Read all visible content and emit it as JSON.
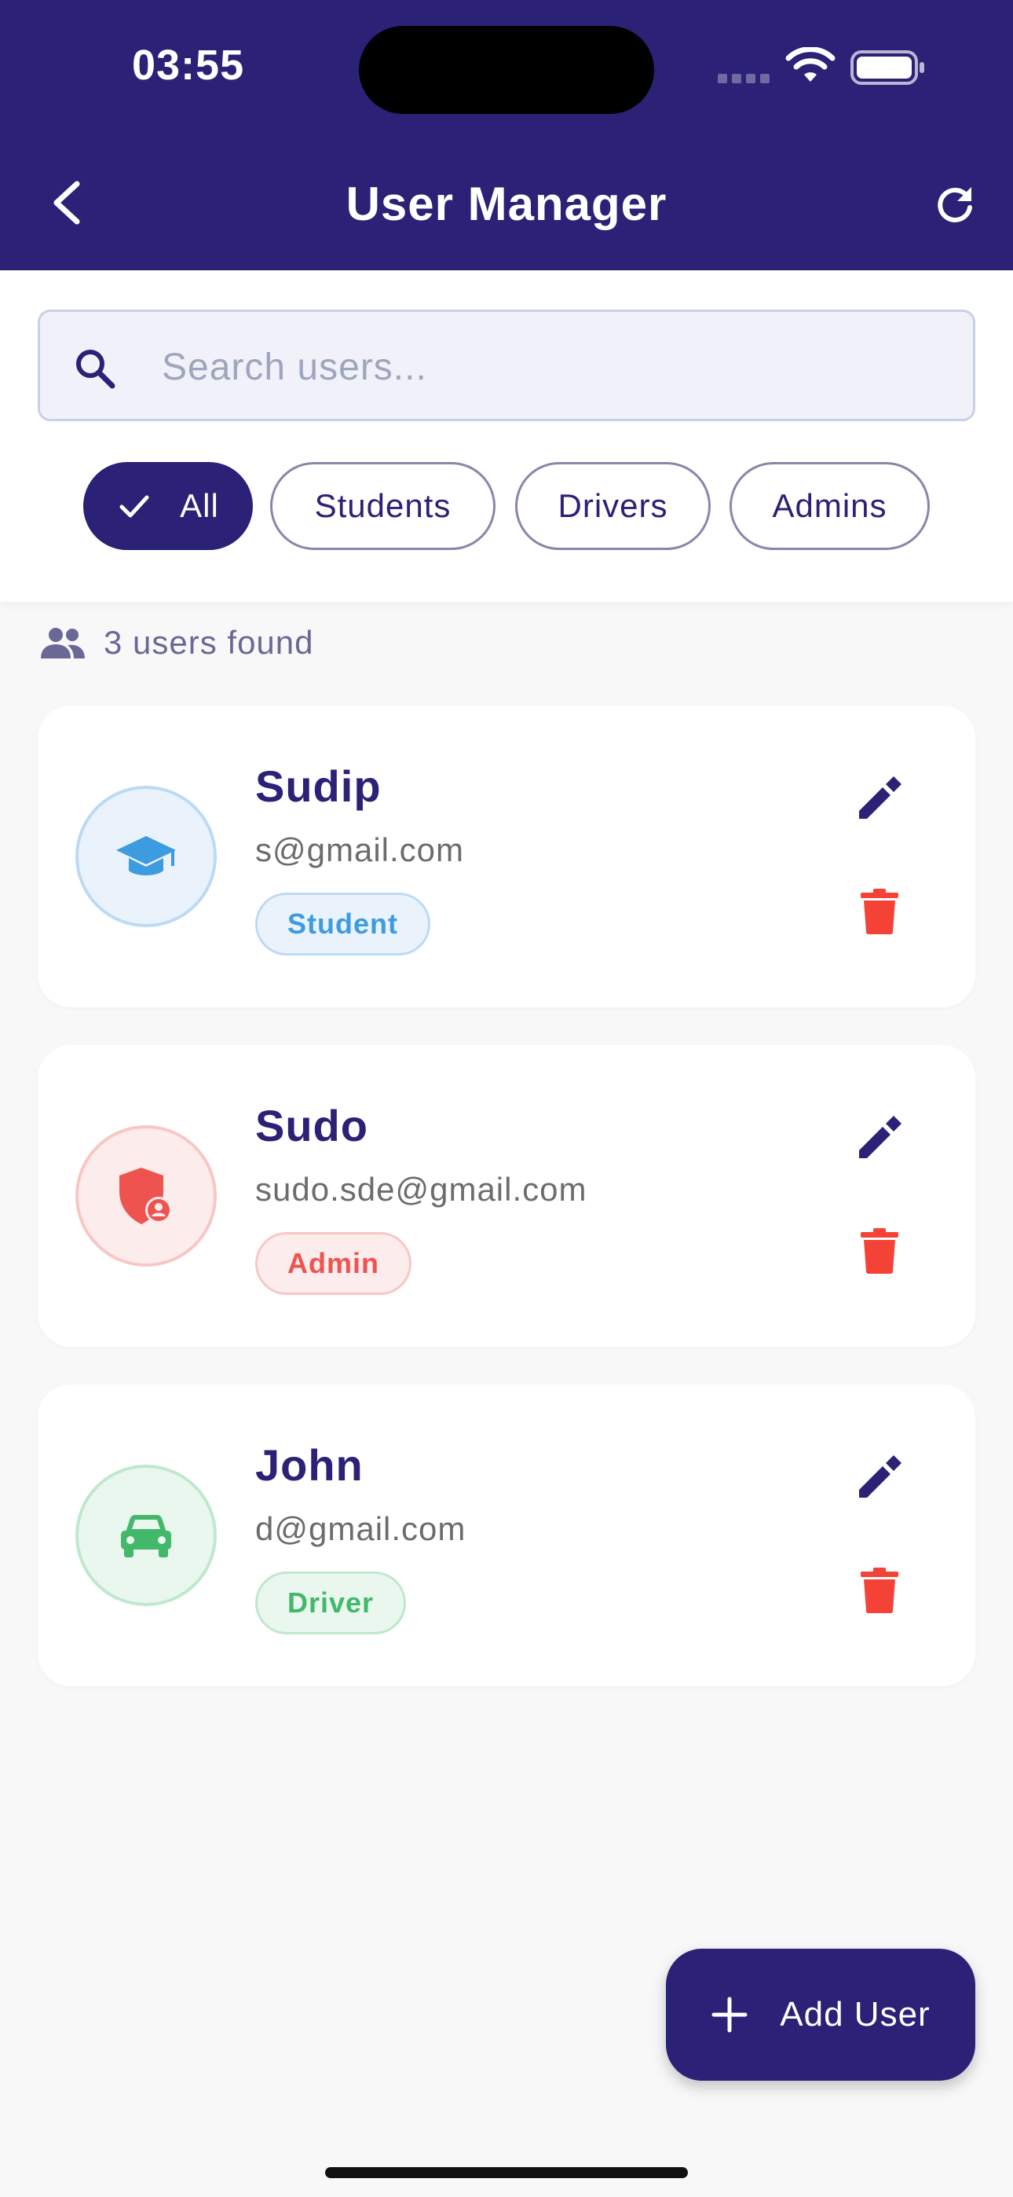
{
  "status_bar": {
    "time": "03:55"
  },
  "header": {
    "title": "User Manager"
  },
  "search": {
    "placeholder": "Search users...",
    "value": ""
  },
  "filters": [
    {
      "label": "All",
      "selected": true
    },
    {
      "label": "Students",
      "selected": false
    },
    {
      "label": "Drivers",
      "selected": false
    },
    {
      "label": "Admins",
      "selected": false
    }
  ],
  "results": {
    "count_text": "3 users found"
  },
  "users": [
    {
      "name": "Sudip",
      "email": "s@gmail.com",
      "role": "Student",
      "icon": "graduation-cap-icon"
    },
    {
      "name": "Sudo",
      "email": "sudo.sde@gmail.com",
      "role": "Admin",
      "icon": "admin-shield-icon"
    },
    {
      "name": "John",
      "email": "d@gmail.com",
      "role": "Driver",
      "icon": "car-icon"
    }
  ],
  "fab": {
    "label": "Add User"
  },
  "colors": {
    "primary": "#2b2176",
    "student": "#3d9be0",
    "admin": "#ef5350",
    "driver": "#43b76a",
    "delete": "#f44336"
  }
}
